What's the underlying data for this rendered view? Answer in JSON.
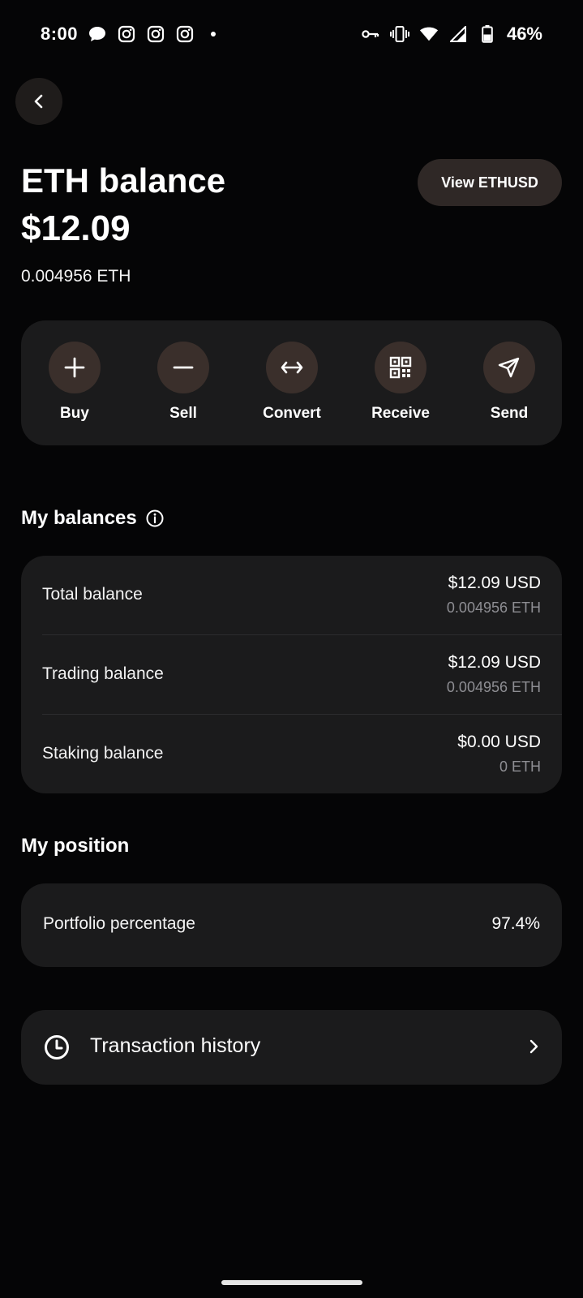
{
  "status_bar": {
    "time": "8:00",
    "battery": "46%",
    "notification_icons": [
      "chat-bubble-icon",
      "instagram-icon",
      "instagram-icon",
      "instagram-icon",
      "dot-icon"
    ],
    "system_icons": [
      "vpn-key-icon",
      "vibrate-icon",
      "wifi-icon",
      "signal-icon",
      "battery-icon"
    ]
  },
  "header": {
    "title": "ETH balance",
    "fiat_balance": "$12.09",
    "crypto_balance": "0.004956 ETH",
    "view_pair_label": "View ETHUSD"
  },
  "actions": [
    {
      "label": "Buy",
      "icon": "plus-icon"
    },
    {
      "label": "Sell",
      "icon": "minus-icon"
    },
    {
      "label": "Convert",
      "icon": "arrows-horizontal-icon"
    },
    {
      "label": "Receive",
      "icon": "qr-code-icon"
    },
    {
      "label": "Send",
      "icon": "send-icon"
    }
  ],
  "balances": {
    "title": "My balances",
    "rows": [
      {
        "label": "Total balance",
        "usd": "$12.09 USD",
        "eth": "0.004956 ETH"
      },
      {
        "label": "Trading balance",
        "usd": "$12.09 USD",
        "eth": "0.004956 ETH"
      },
      {
        "label": "Staking balance",
        "usd": "$0.00 USD",
        "eth": "0 ETH"
      }
    ]
  },
  "position": {
    "title": "My position",
    "label": "Portfolio percentage",
    "value": "97.4%"
  },
  "history": {
    "label": "Transaction history"
  },
  "colors": {
    "background": "#050506",
    "card": "#1b1b1c",
    "action_circle": "#3a2f2b",
    "secondary_text": "#8e8e93"
  }
}
